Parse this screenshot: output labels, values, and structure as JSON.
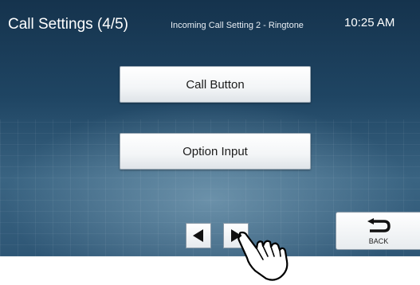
{
  "header": {
    "title": "Call Settings (4/5)",
    "subtitle": "Incoming Call Setting 2 - Ringtone",
    "time": "10:25 AM"
  },
  "menu": {
    "items": [
      {
        "label": "Call Button"
      },
      {
        "label": "Option Input"
      }
    ]
  },
  "nav": {
    "prev_icon": "left-triangle-icon",
    "next_icon": "right-triangle-icon"
  },
  "back": {
    "label": "BACK",
    "icon": "return-arrow-icon"
  },
  "overlay": {
    "icon": "pointing-hand-icon"
  },
  "colors": {
    "background_top": "#15334d",
    "background_bottom": "#3a6482",
    "button_face": "#ffffff",
    "text_light": "#ffffff"
  }
}
